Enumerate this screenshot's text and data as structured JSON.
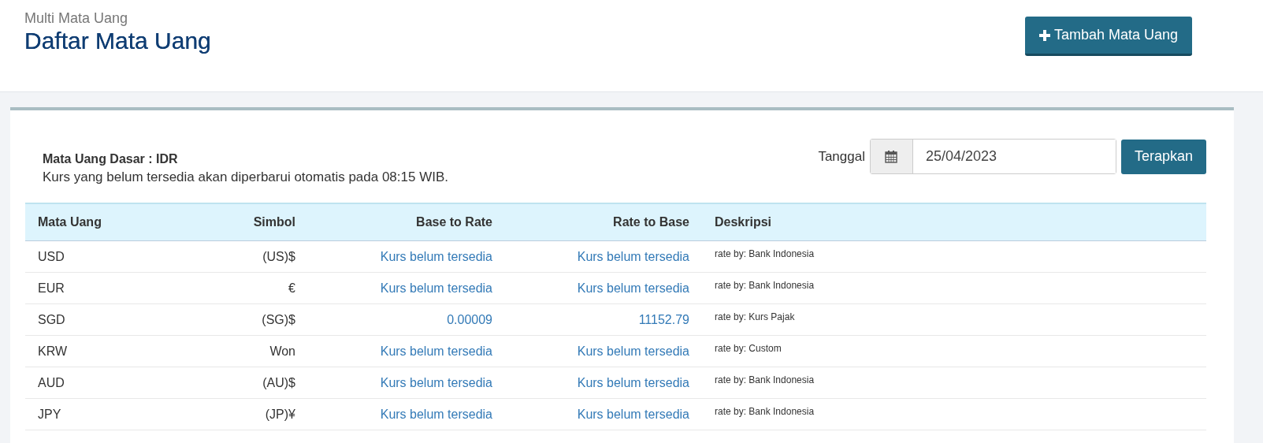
{
  "header": {
    "subtitle": "Multi Mata Uang",
    "title": "Daftar Mata Uang",
    "add_button": "Tambah Mata Uang"
  },
  "info": {
    "base_currency": "Mata Uang Dasar : IDR",
    "note": "Kurs yang belum tersedia akan diperbarui otomatis pada 08:15 WIB."
  },
  "date_filter": {
    "label": "Tanggal",
    "value": "25/04/2023",
    "apply_button": "Terapkan"
  },
  "table": {
    "columns": [
      "Mata Uang",
      "Simbol",
      "Base to Rate",
      "Rate to Base",
      "Deskripsi"
    ],
    "rows": [
      {
        "currency": "USD",
        "symbol": "(US)$",
        "base_to_rate": "Kurs belum tersedia",
        "rate_to_base": "Kurs belum tersedia",
        "description": "rate by: Bank Indonesia"
      },
      {
        "currency": "EUR",
        "symbol": "€",
        "base_to_rate": "Kurs belum tersedia",
        "rate_to_base": "Kurs belum tersedia",
        "description": "rate by: Bank Indonesia"
      },
      {
        "currency": "SGD",
        "symbol": "(SG)$",
        "base_to_rate": "0.00009",
        "rate_to_base": "11152.79",
        "description": "rate by: Kurs Pajak"
      },
      {
        "currency": "KRW",
        "symbol": "Won",
        "base_to_rate": "Kurs belum tersedia",
        "rate_to_base": "Kurs belum tersedia",
        "description": "rate by: Custom"
      },
      {
        "currency": "AUD",
        "symbol": "(AU)$",
        "base_to_rate": "Kurs belum tersedia",
        "rate_to_base": "Kurs belum tersedia",
        "description": "rate by: Bank Indonesia"
      },
      {
        "currency": "JPY",
        "symbol": "(JP)¥",
        "base_to_rate": "Kurs belum tersedia",
        "rate_to_base": "Kurs belum tersedia",
        "description": "rate by: Bank Indonesia"
      }
    ]
  }
}
